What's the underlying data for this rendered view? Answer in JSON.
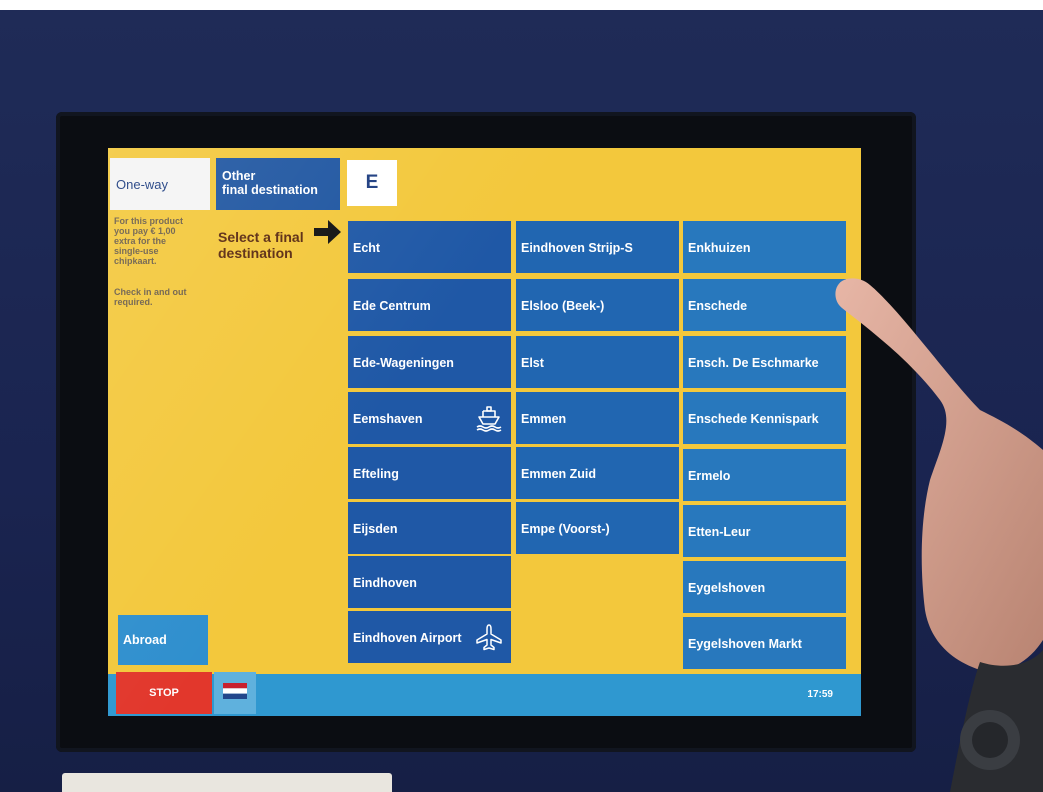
{
  "header": {
    "oneway_tab": "One-way",
    "other_dest_tab_line1": "Other",
    "other_dest_tab_line2": "final destination",
    "letter": "E"
  },
  "info": {
    "note_lines": [
      "For this product",
      "you pay € 1,00",
      "extra for the",
      "single-use",
      "chipkaart."
    ],
    "check_lines": [
      "Check in and out",
      "required."
    ]
  },
  "select_label_lines": [
    "Select a final",
    "destination"
  ],
  "destinations": {
    "col1": [
      "Echt",
      "Ede Centrum",
      "Ede-Wageningen",
      "Eemshaven",
      "Efteling",
      "Eijsden",
      "Eindhoven",
      "Eindhoven Airport"
    ],
    "col2": [
      "Eindhoven Strijp-S",
      "Elsloo (Beek-)",
      "Elst",
      "Emmen",
      "Emmen Zuid",
      "Empe (Voorst-)"
    ],
    "col3": [
      "Enkhuizen",
      "Enschede",
      "Ensch. De Eschmarke",
      "Enschede Kennispark",
      "Ermelo",
      "Etten-Leur",
      "Eygelshoven",
      "Eygelshoven Markt"
    ]
  },
  "icons": {
    "eemshaven": "ferry-icon",
    "eindhoven_airport": "airplane-icon",
    "language": "netherlands-flag-icon",
    "arrow": "arrow-right-icon"
  },
  "footer": {
    "abroad": "Abroad",
    "stop": "STOP",
    "time": "17:59"
  },
  "colors": {
    "screen_bg": "#f3c83c",
    "button_blue": "#2166b1",
    "stop_red": "#e2372c",
    "bar_blue": "#2f98d0"
  }
}
